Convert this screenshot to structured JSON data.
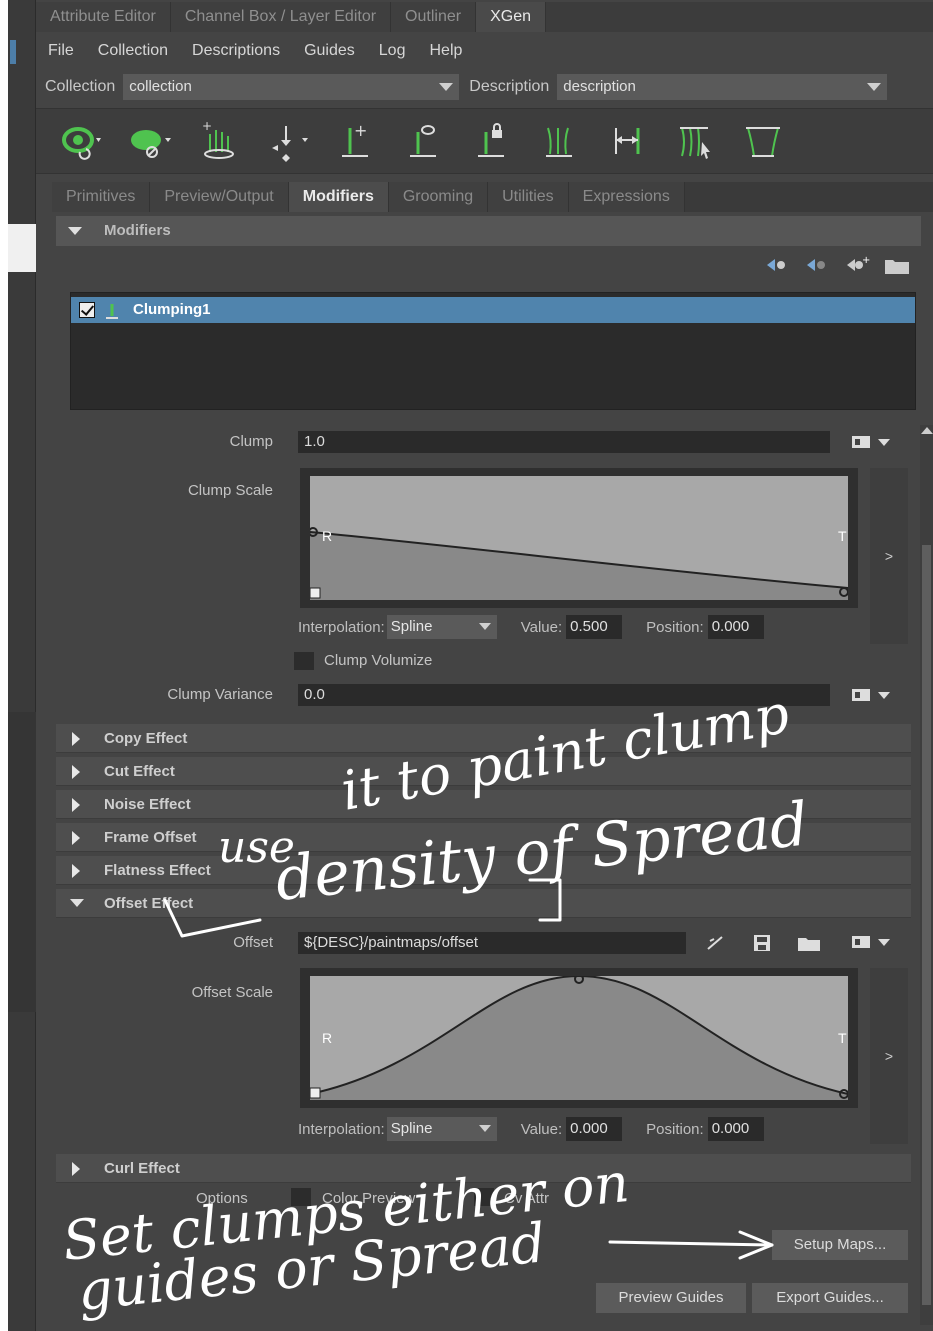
{
  "window": {
    "tabs": [
      "Attribute Editor",
      "Channel Box / Layer Editor",
      "Outliner",
      "XGen"
    ],
    "active_tab": "XGen"
  },
  "menu": [
    "File",
    "Collection",
    "Descriptions",
    "Guides",
    "Log",
    "Help"
  ],
  "collection": {
    "label": "Collection",
    "value": "collection"
  },
  "description": {
    "label": "Description",
    "value": "description"
  },
  "toolbar_icons": [
    "visibility-eye-icon",
    "create-description-icon",
    "guides-select-icon",
    "guides-move-icon",
    "add-guide-icon",
    "guide-sculpt-icon",
    "guide-lock-icon",
    "guide-rebuild-icon",
    "guide-length-icon",
    "guide-comb-icon",
    "guide-bend-icon"
  ],
  "subtabs": [
    "Primitives",
    "Preview/Output",
    "Modifiers",
    "Grooming",
    "Utilities",
    "Expressions"
  ],
  "active_subtab": "Modifiers",
  "modifiers_header": "Modifiers",
  "modifier_list": [
    {
      "name": "Clumping1",
      "checked": true
    }
  ],
  "clump": {
    "label": "Clump",
    "value": "1.0"
  },
  "clump_scale": {
    "label": "Clump Scale",
    "left_marker": "R",
    "right_marker": "T",
    "interpolation_label": "Interpolation:",
    "interpolation": "Spline",
    "value_label": "Value:",
    "value": "0.500",
    "position_label": "Position:",
    "position": "0.000",
    "expand": ">"
  },
  "clump_volumize": {
    "label": "Clump Volumize",
    "checked": false
  },
  "clump_variance": {
    "label": "Clump Variance",
    "value": "0.0"
  },
  "effects": [
    "Copy Effect",
    "Cut Effect",
    "Noise Effect",
    "Frame Offset",
    "Flatness Effect"
  ],
  "offset_effect": "Offset Effect",
  "offset": {
    "label": "Offset",
    "value": "${DESC}/paintmaps/offset"
  },
  "offset_scale": {
    "label": "Offset Scale",
    "left_marker": "R",
    "right_marker": "T",
    "interpolation_label": "Interpolation:",
    "interpolation": "Spline",
    "value_label": "Value:",
    "value": "0.000",
    "position_label": "Position:",
    "position": "0.000",
    "expand": ">"
  },
  "curl_effect": "Curl Effect",
  "options": {
    "label": "Options",
    "color_preview": "Color Preview",
    "cv_attr": "Cv Attr"
  },
  "buttons": {
    "setup_maps": "Setup Maps...",
    "preview_guides": "Preview Guides",
    "export_guides": "Export Guides..."
  },
  "handwriting": [
    "it to paint clump",
    "use",
    "density of Spread",
    "Set clumps either on",
    "guides or Spread"
  ],
  "colors": {
    "accent_selection": "#5084ad",
    "icon_green": "#4fc34f",
    "panel": "#444444"
  }
}
